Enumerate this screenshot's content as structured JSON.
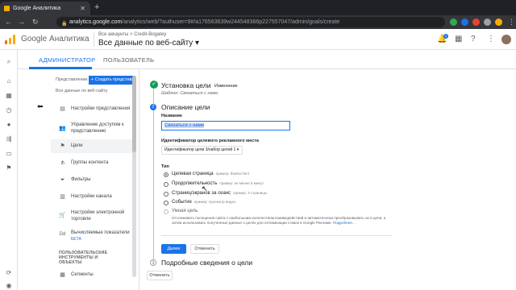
{
  "browser": {
    "tab_title": "Google Аналитика",
    "url_host": "analytics.google.com",
    "url_path": "/analytics/web/?authuser=9#/a176563639w244548366p227557047/admin/goals/create"
  },
  "header": {
    "brand": "Google Аналитика",
    "breadcrumb": "Все аккаунты > Credit-Bogatey",
    "account_view": "Все данные по веб-сайту ▾",
    "notifications_count": "1"
  },
  "tabs": [
    {
      "label": "АДМИНИСТРАТОР"
    },
    {
      "label": "ПОЛЬЗОВАТЕЛЬ"
    }
  ],
  "admin": {
    "view_label": "Представление",
    "create_label": "+ Создать представление",
    "view_name": "Все данные по веб-сайту",
    "items": [
      {
        "label": "Настройки представления",
        "icon": "doc-icon"
      },
      {
        "label": "Управление доступом к представлению",
        "icon": "people-icon"
      },
      {
        "label": "Цели",
        "icon": "flag-icon"
      },
      {
        "label": "Группы контента",
        "icon": "hierarchy-icon"
      },
      {
        "label": "Фильтры",
        "icon": "filter-icon"
      },
      {
        "label": "Настройки канала",
        "icon": "channel-icon"
      },
      {
        "label": "Настройки электронной торговли",
        "icon": "cart-icon"
      },
      {
        "label": "Вычисляемые показатели",
        "icon": "calc-icon",
        "badge": "БЕТА"
      },
      {
        "label": "Сегменты",
        "icon": "segments-icon"
      }
    ],
    "section_title_1": "ПОЛЬЗОВАТЕЛЬСКИЕ ИНСТРУМЕНТЫ И",
    "section_title_2": "ОБЪЕКТЫ"
  },
  "goal": {
    "step1_title": "Установка цели",
    "step1_change": "Изменение",
    "step1_template": "Шаблон: Связаться с нами",
    "step2_num": "2",
    "step2_title": "Описание цели",
    "name_label": "Название",
    "name_value": "Связаться с нами",
    "slot_label": "Идентификатор целевого рекламного места",
    "slot_value": "Идентификатор цели 3/набор целей 1 ▾",
    "type_label": "Тип",
    "types": [
      {
        "label": "Целевая страница",
        "example": "пример: thanks.html",
        "selected": true
      },
      {
        "label": "Продолжительность",
        "example": "пример: не менее 5 минут",
        "selected": false
      },
      {
        "label": "Страниц/экранов за сеанс",
        "example": "пример: 3 страницы",
        "selected": false
      },
      {
        "label": "Событие",
        "example": "пример: просмотр видео",
        "selected": false
      },
      {
        "label": "Умная цель",
        "example": "",
        "selected": false
      }
    ],
    "smart_desc": "Отслеживать посещения сайта с наибольшим количеством взаимодействий и автоматически преобразовывать их в цели, а затем использовать полученные данные о целях для оптимизации ставок в Google Рекламе.",
    "smart_link": "Подробнее...",
    "continue_label": "Далее",
    "cancel_label": "Отменить",
    "step3_num": "3",
    "step3_title": "Подробные сведения о цели",
    "cancel_bottom_label": "Отменить"
  }
}
